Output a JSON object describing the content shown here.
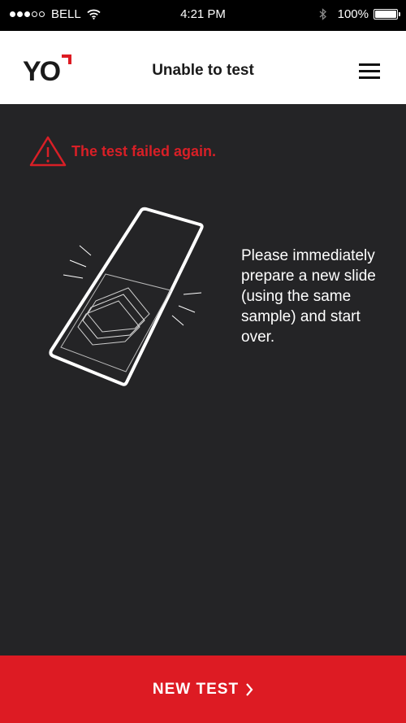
{
  "status_bar": {
    "carrier": "BELL",
    "time": "4:21 PM",
    "battery": "100%",
    "signal_bars_filled": 3,
    "signal_bars_total": 5
  },
  "header": {
    "logo_text": "YO",
    "title": "Unable to test",
    "menu_icon": "hamburger-icon"
  },
  "alert": {
    "icon": "warning-triangle-icon",
    "message": "The test failed again."
  },
  "instructions": {
    "text": "Please immediately prepare a new slide (using the same sample) and start over."
  },
  "primary_action": {
    "label": "NEW TEST",
    "icon": "chevron-right-icon"
  },
  "colors": {
    "background": "#242426",
    "accent": "#dd1b23",
    "header_bg": "#ffffff",
    "text_on_dark": "#ffffff"
  }
}
